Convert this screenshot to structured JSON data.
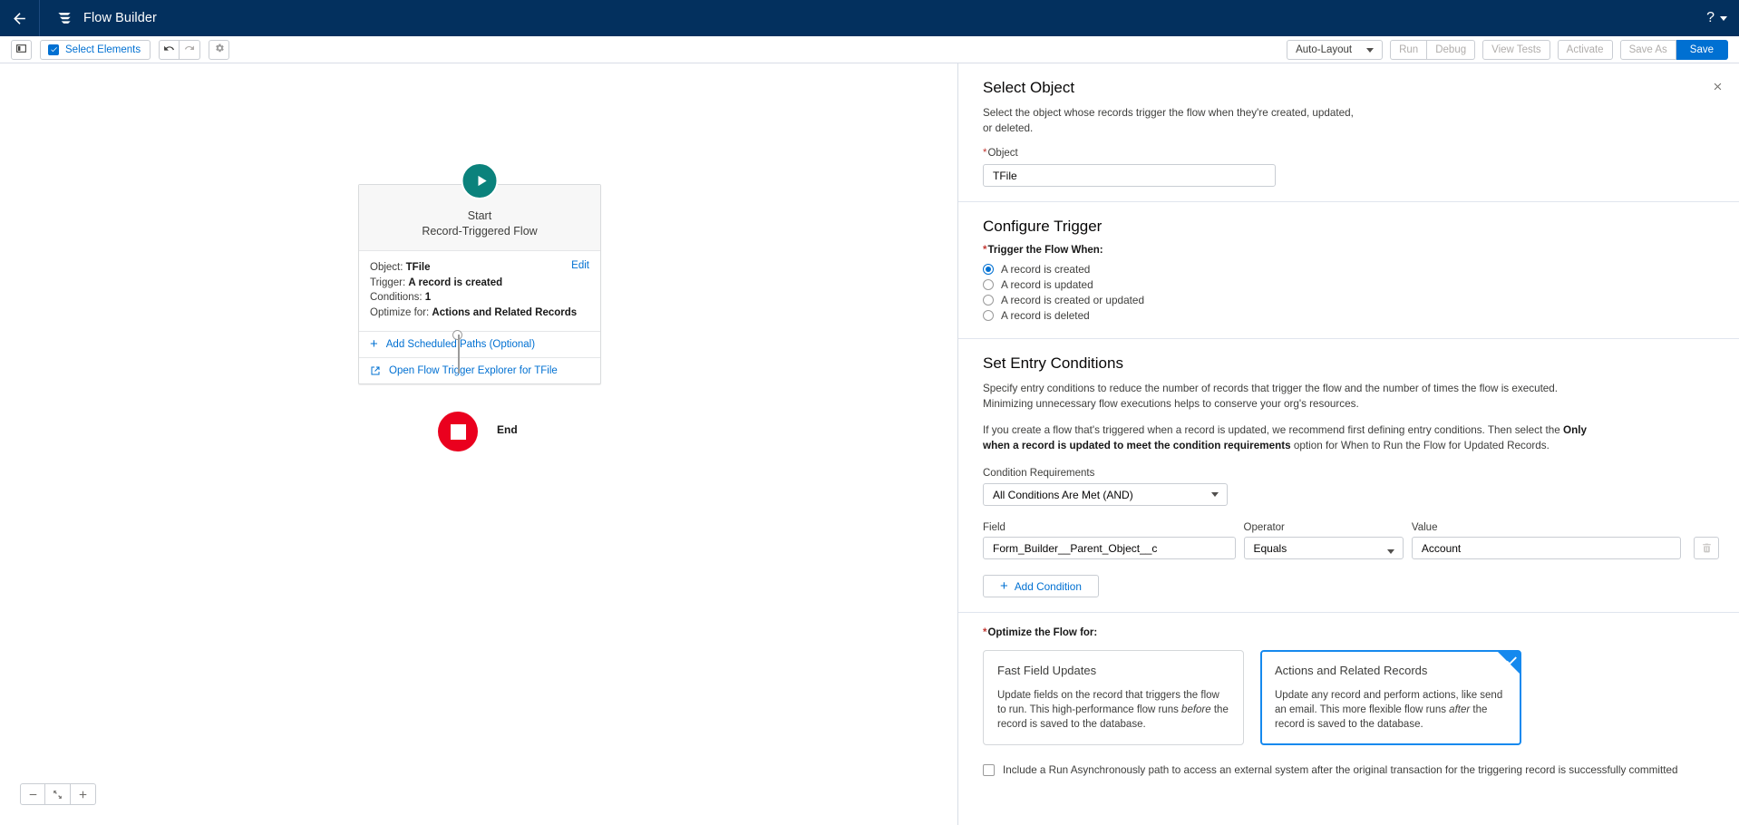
{
  "header": {
    "back_icon": "arrow-left-icon",
    "brand_icon": "flow-builder-logo-icon",
    "title": "Flow Builder",
    "help_icon": "help-question-icon"
  },
  "toolbar": {
    "panel_toggle_icon": "toggle-left-panel-icon",
    "select_elements_label": "Select Elements",
    "select_elements_icon": "checkbox-selection-icon",
    "undo_icon": "undo-icon",
    "redo_icon": "redo-icon",
    "settings_icon": "gear-icon",
    "layout_value": "Auto-Layout",
    "run_label": "Run",
    "debug_label": "Debug",
    "view_tests_label": "View Tests",
    "activate_label": "Activate",
    "save_as_label": "Save As",
    "save_label": "Save"
  },
  "canvas": {
    "start_node": {
      "play_icon": "play-icon",
      "title": "Start",
      "subtitle": "Record-Triggered Flow",
      "edit_label": "Edit",
      "rows": [
        {
          "label": "Object:",
          "value": "TFile"
        },
        {
          "label": "Trigger:",
          "value": "A record is created"
        },
        {
          "label": "Conditions:",
          "value": "1"
        },
        {
          "label": "Optimize for:",
          "value": "Actions and Related Records"
        }
      ],
      "add_scheduled_paths_label": "Add Scheduled Paths (Optional)",
      "trigger_explorer_label": "Open Flow Trigger Explorer for TFile"
    },
    "end_node": {
      "label": "End"
    },
    "zoom": {
      "out_icon": "zoom-out-icon",
      "fit_icon": "fit-to-view-icon",
      "in_icon": "zoom-in-icon"
    }
  },
  "panel": {
    "close_icon": "close-icon",
    "select_object": {
      "title": "Select Object",
      "description": "Select the object whose records trigger the flow when they're created, updated, or deleted.",
      "object_label": "Object",
      "object_value": "TFile"
    },
    "configure_trigger": {
      "title": "Configure Trigger",
      "trigger_when_label": "Trigger the Flow When:",
      "options": [
        {
          "label": "A record is created",
          "selected": true
        },
        {
          "label": "A record is updated",
          "selected": false
        },
        {
          "label": "A record is created or updated",
          "selected": false
        },
        {
          "label": "A record is deleted",
          "selected": false
        }
      ]
    },
    "entry_conditions": {
      "title": "Set Entry Conditions",
      "paragraph_1": "Specify entry conditions to reduce the number of records that trigger the flow and the number of times the flow is executed. Minimizing unnecessary flow executions helps to conserve your org's resources.",
      "paragraph_2_before": "If you create a flow that's triggered when a record is updated, we recommend first defining entry conditions. Then select the ",
      "paragraph_2_bold": "Only when a record is updated to meet the condition requirements",
      "paragraph_2_after": " option for When to Run the Flow for Updated Records.",
      "condition_requirements_label": "Condition Requirements",
      "condition_requirements_value": "All Conditions Are Met (AND)",
      "field_label": "Field",
      "operator_label": "Operator",
      "value_label": "Value",
      "field_value": "Form_Builder__Parent_Object__c",
      "operator_value": "Equals",
      "value_value": "Account",
      "delete_icon": "trash-icon",
      "add_condition_label": "Add Condition"
    },
    "optimize": {
      "label": "Optimize the Flow for:",
      "cards": [
        {
          "title": "Fast Field Updates",
          "desc_before": "Update fields on the record that triggers the flow to run. This high-performance flow runs ",
          "desc_italic": "before",
          "desc_after": " the record is saved to the database.",
          "selected": false
        },
        {
          "title": "Actions and Related Records",
          "desc_before": "Update any record and perform actions, like send an email. This more flexible flow runs ",
          "desc_italic": "after",
          "desc_after": " the record is saved to the database.",
          "selected": true
        }
      ],
      "async_label": "Include a Run Asynchronously path to access an external system after the original transaction for the triggering record is successfully committed",
      "async_checked": false
    }
  },
  "colors": {
    "header_bg": "#03305e",
    "brand_blue": "#0070d2",
    "start_green": "#0b827c",
    "end_red": "#ea001e",
    "required_red": "#c23934",
    "selected_border": "#1589ee"
  }
}
